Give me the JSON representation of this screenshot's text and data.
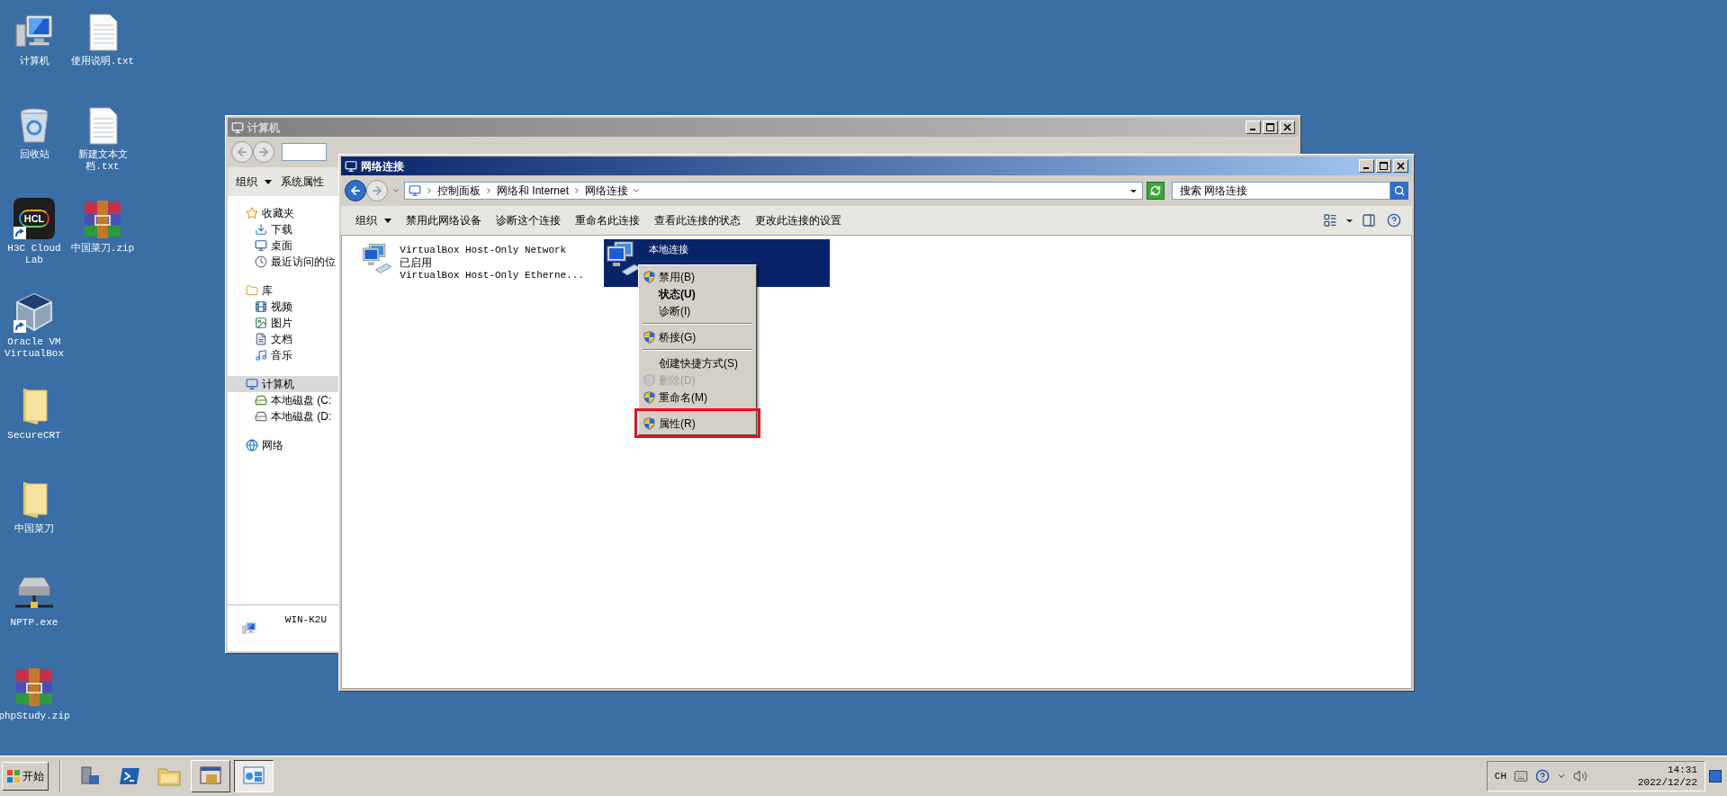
{
  "desktop_rows": [
    {
      "icons": [
        {
          "label": "计算机",
          "kind": "computer",
          "shortcut": false
        },
        {
          "label": "使用说明.txt",
          "kind": "text-file",
          "shortcut": false
        }
      ]
    },
    {
      "icons": [
        {
          "label": "回收站",
          "kind": "recycle-bin",
          "shortcut": false
        },
        {
          "label": "新建文本文档.txt",
          "kind": "text-file",
          "shortcut": false
        }
      ]
    },
    {
      "icons": [
        {
          "label": "H3C Cloud Lab",
          "kind": "app-tile",
          "logo_text": "HCL",
          "shortcut": true
        },
        {
          "label": "中国菜刀.zip",
          "kind": "archive",
          "shortcut": false
        }
      ]
    },
    {
      "icons": [
        {
          "label": "Oracle VM VirtualBox",
          "kind": "cube",
          "shortcut": true
        }
      ]
    },
    {
      "icons": [
        {
          "label": "SecureCRT",
          "kind": "folder",
          "shortcut": false
        }
      ]
    },
    {
      "icons": [
        {
          "label": "中国菜刀",
          "kind": "folder",
          "shortcut": false
        }
      ]
    },
    {
      "icons": [
        {
          "label": "NPTP.exe",
          "kind": "network-drive",
          "shortcut": false
        }
      ]
    },
    {
      "icons": [
        {
          "label": "phpStudy.zip",
          "kind": "archive",
          "shortcut": false
        }
      ]
    }
  ],
  "back_window": {
    "title": "计算机",
    "toolbar": [
      {
        "label": "组织",
        "menu": true
      },
      {
        "label": "系统属性",
        "menu": false
      }
    ],
    "sidebar": [
      {
        "label": "收藏夹",
        "kind": "favorites",
        "selected": false,
        "children": [
          {
            "label": "下载",
            "kind": "downloads",
            "selected": false
          },
          {
            "label": "桌面",
            "kind": "desktop",
            "selected": false
          },
          {
            "label": "最近访问的位",
            "kind": "recent",
            "selected": false
          }
        ]
      },
      {
        "label": "库",
        "kind": "library",
        "selected": false,
        "children": [
          {
            "label": "视频",
            "kind": "video",
            "selected": false
          },
          {
            "label": "图片",
            "kind": "pictures",
            "selected": false
          },
          {
            "label": "文档",
            "kind": "documents",
            "selected": false
          },
          {
            "label": "音乐",
            "kind": "music",
            "selected": false
          }
        ]
      },
      {
        "label": "计算机",
        "kind": "computer",
        "selected": true,
        "children": [
          {
            "label": "本地磁盘 (C:",
            "kind": "system-disk",
            "selected": false
          },
          {
            "label": "本地磁盘 (D:",
            "kind": "disk",
            "selected": false
          }
        ]
      },
      {
        "label": "网络",
        "kind": "network",
        "selected": false
      }
    ],
    "details": {
      "name": "WIN-K2U"
    }
  },
  "front_window": {
    "title": "网络连接",
    "breadcrumb": [
      "控制面板",
      "网络和 Internet",
      "网络连接"
    ],
    "search": {
      "placeholder": "搜索 网络连接"
    },
    "toolbar": [
      {
        "label": "组织",
        "menu": true
      },
      {
        "label": "禁用此网络设备",
        "menu": false
      },
      {
        "label": "诊断这个连接",
        "menu": false
      },
      {
        "label": "重命名此连接",
        "menu": false
      },
      {
        "label": "查看此连接的状态",
        "menu": false
      },
      {
        "label": "更改此连接的设置",
        "menu": false
      }
    ],
    "connections": [
      {
        "name": "VirtualBox Host-Only Network",
        "status": "已启用",
        "device": "VirtualBox Host-Only Etherne...",
        "selected": false
      },
      {
        "name": "本地连接",
        "selected": true
      }
    ]
  },
  "context_menu": {
    "items": [
      {
        "kind": "item",
        "label": "禁用(B)",
        "shield": true,
        "bold": false,
        "disabled": false,
        "highlighted": false
      },
      {
        "kind": "item",
        "label": "状态(U)",
        "shield": false,
        "bold": true,
        "disabled": false,
        "highlighted": false
      },
      {
        "kind": "item",
        "label": "诊断(I)",
        "shield": false,
        "bold": false,
        "disabled": false,
        "highlighted": false
      },
      {
        "kind": "separator"
      },
      {
        "kind": "item",
        "label": "桥接(G)",
        "shield": true,
        "bold": false,
        "disabled": false,
        "highlighted": false
      },
      {
        "kind": "separator"
      },
      {
        "kind": "item",
        "label": "创建快捷方式(S)",
        "shield": false,
        "bold": false,
        "disabled": false,
        "highlighted": false
      },
      {
        "kind": "item",
        "label": "删除(D)",
        "shield": true,
        "bold": false,
        "disabled": true,
        "highlighted": false
      },
      {
        "kind": "item",
        "label": "重命名(M)",
        "shield": true,
        "bold": false,
        "disabled": false,
        "highlighted": false
      },
      {
        "kind": "separator"
      },
      {
        "kind": "item",
        "label": "属性(R)",
        "shield": true,
        "bold": false,
        "disabled": false,
        "highlighted": true
      }
    ]
  },
  "taskbar": {
    "start": "开始",
    "quick_launch": [
      {
        "kind": "server-manager"
      },
      {
        "kind": "powershell"
      },
      {
        "kind": "explorer"
      }
    ],
    "windows": [
      {
        "kind": "explorer-window",
        "selected": false
      },
      {
        "kind": "network-window",
        "selected": true
      }
    ],
    "tray": {
      "language": "CH",
      "time": "14:31",
      "date": "2022/12/22"
    }
  }
}
